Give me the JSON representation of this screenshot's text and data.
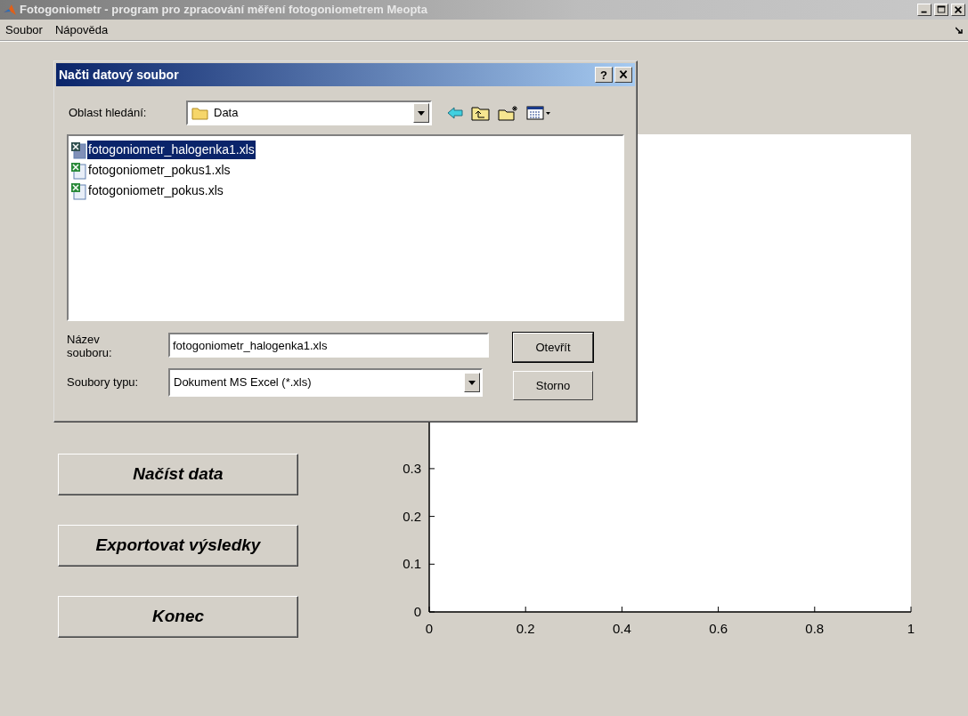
{
  "window": {
    "title": "Fotogoniometr - program pro zpracování měření fotogoniometrem Meopta"
  },
  "menu": [
    "Soubor",
    "Nápověda"
  ],
  "dialog": {
    "title": "Načti datový soubor",
    "help": "?",
    "look_in": {
      "label": "Oblast hledání:",
      "value": "Data"
    },
    "files": [
      {
        "name": "fotogoniometr_halogenka1.xls",
        "selected": true
      },
      {
        "name": "fotogoniometr_pokus1.xls",
        "selected": false
      },
      {
        "name": "fotogoniometr_pokus.xls",
        "selected": false
      }
    ],
    "file_name": {
      "label": "Název souboru:",
      "value": "fotogoniometr_halogenka1.xls"
    },
    "file_type": {
      "label": "Soubory typu:",
      "value": "Dokument MS Excel (*.xls)"
    },
    "buttons": [
      {
        "label": "Otevřít",
        "default": true
      },
      {
        "label": "Storno",
        "default": false
      }
    ]
  },
  "actions": [
    "Načíst data",
    "Exportovat výsledky",
    "Konec"
  ],
  "plot": {
    "chart_data": {
      "type": "line",
      "xlim": [
        0,
        1
      ],
      "ylim": [
        0,
        1
      ],
      "xticks": [
        0,
        0.2,
        0.4,
        0.6,
        0.8,
        1
      ],
      "yticks": [
        0,
        0.1,
        0.2,
        0.3
      ]
    }
  }
}
